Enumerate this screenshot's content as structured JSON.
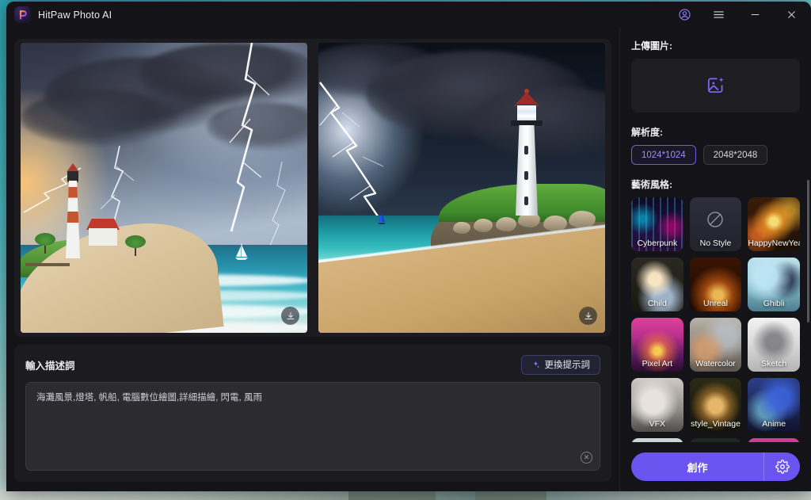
{
  "window": {
    "app_title": "HitPaw Photo AI",
    "logo_letter": "P",
    "titlebar_buttons": [
      {
        "name": "account-icon",
        "label": ""
      },
      {
        "name": "menu-icon",
        "label": ""
      },
      {
        "name": "minimize-button",
        "label": ""
      },
      {
        "name": "close-button",
        "label": ""
      }
    ]
  },
  "results": {
    "images": [
      {
        "alt": "Stormy beach with red-and-white striped lighthouse, house, sailboat and lightning",
        "download_label": ""
      },
      {
        "alt": "Dark stormy coast with white lighthouse on grassy cliff and lightning over the sea",
        "download_label": ""
      }
    ]
  },
  "prompt": {
    "title": "輸入描述詞",
    "change_button": "更換提示詞",
    "value": "海灘風景,燈塔, 帆船, 電腦數位繪圖,詳細描繪, 閃電, 風雨",
    "placeholder": "輸入描述詞",
    "clear_glyph": "✕"
  },
  "sidebar": {
    "upload_label": "上傳圖片:",
    "upload_icon": "image-sparkle-icon",
    "resolution_label": "解析度:",
    "resolutions": [
      {
        "label": "1024*1024",
        "selected": true
      },
      {
        "label": "2048*2048",
        "selected": false
      }
    ],
    "style_label": "藝術風格:",
    "styles": [
      {
        "label": "Cyberpunk",
        "thumb": "tb-cyberpunk",
        "selected": true
      },
      {
        "label": "No Style",
        "thumb": "tb-nostyle",
        "selected": false
      },
      {
        "label": "HappyNewYear",
        "thumb": "tb-happy",
        "selected": false
      },
      {
        "label": "Child",
        "thumb": "tb-child",
        "selected": false
      },
      {
        "label": "Unreal",
        "thumb": "tb-unreal",
        "selected": false
      },
      {
        "label": "Ghibli",
        "thumb": "tb-ghibli",
        "selected": false
      },
      {
        "label": "Pixel Art",
        "thumb": "tb-pixel",
        "selected": false
      },
      {
        "label": "Watercolor",
        "thumb": "tb-watercolor",
        "selected": false
      },
      {
        "label": "Sketch",
        "thumb": "tb-sketch",
        "selected": false
      },
      {
        "label": "VFX",
        "thumb": "tb-vfx",
        "selected": false
      },
      {
        "label": "style_Vintage",
        "thumb": "tb-vintage",
        "selected": false
      },
      {
        "label": "Anime",
        "thumb": "tb-anime",
        "selected": false
      },
      {
        "label": "",
        "thumb": "tb-row4a",
        "selected": false
      },
      {
        "label": "",
        "thumb": "tb-row4b",
        "selected": false
      },
      {
        "label": "",
        "thumb": "tb-row4c",
        "selected": false
      }
    ]
  },
  "footer": {
    "create_label": "創作",
    "settings_icon": "gear-icon"
  },
  "colors": {
    "accent": "#6c54f0",
    "accent_text": "#9c8dff",
    "panel": "#1b1b20",
    "window_bg": "#141418",
    "desktop": "#3fb3bd"
  }
}
